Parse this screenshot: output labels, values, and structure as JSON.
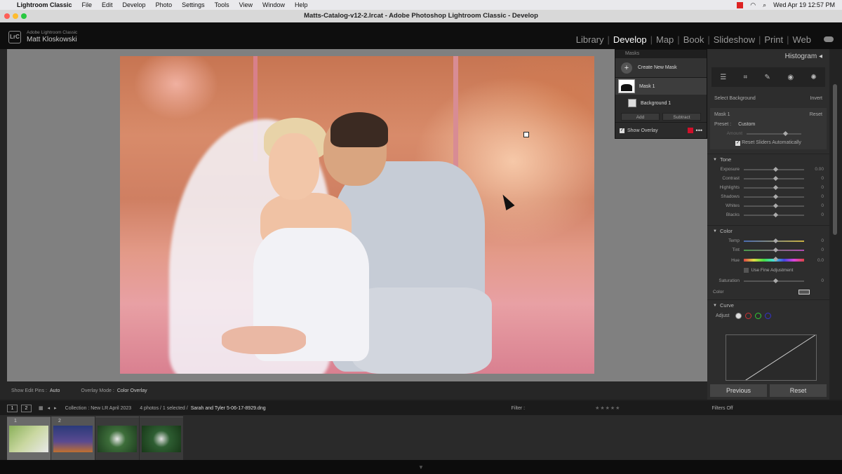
{
  "menubar": {
    "app": "Lightroom Classic",
    "items": [
      "File",
      "Edit",
      "Develop",
      "Photo",
      "Settings",
      "Tools",
      "View",
      "Window",
      "Help"
    ],
    "datetime": "Wed Apr 19  12:57 PM"
  },
  "window": {
    "title": "Matts-Catalog-v12-2.lrcat - Adobe Photoshop Lightroom Classic - Develop"
  },
  "identity": {
    "badge": "LrC",
    "product": "Adobe Lightroom Classic",
    "user": "Matt Kloskowski"
  },
  "modules": [
    {
      "label": "Library"
    },
    {
      "label": "Develop"
    },
    {
      "label": "Map"
    },
    {
      "label": "Book"
    },
    {
      "label": "Slideshow"
    },
    {
      "label": "Print"
    },
    {
      "label": "Web"
    }
  ],
  "masks": {
    "header": "Masks",
    "create_label": "Create New Mask",
    "mask1_label": "Mask 1",
    "component_label": "Background 1",
    "add_label": "Add",
    "subtract_label": "Subtract",
    "show_overlay_label": "Show Overlay",
    "overlay_color": "#d0102a"
  },
  "right_panel": {
    "histogram_label": "Histogram",
    "select_bg_label": "Select Background",
    "invert_label": "Invert",
    "mask_name": "Mask 1",
    "reset_label": "Reset",
    "preset_label": "Preset :",
    "preset_value": "Custom",
    "amount_label": "Amount",
    "reset_sliders_label": "Reset Sliders Automatically",
    "tone_label": "Tone",
    "tone": [
      {
        "label": "Exposure",
        "value": "0.00"
      },
      {
        "label": "Contrast",
        "value": "0"
      },
      {
        "label": "Highlights",
        "value": "0"
      },
      {
        "label": "Shadows",
        "value": "0"
      },
      {
        "label": "Whites",
        "value": "0"
      },
      {
        "label": "Blacks",
        "value": "0"
      }
    ],
    "color_label": "Color",
    "color": [
      {
        "label": "Temp",
        "value": "0"
      },
      {
        "label": "Tint",
        "value": "0"
      },
      {
        "label": "Hue",
        "value": "0.0"
      }
    ],
    "fine_adj_label": "Use Fine Adjustment",
    "saturation": {
      "label": "Saturation",
      "value": "0"
    },
    "color_swatch_label": "Color",
    "curve_label": "Curve",
    "adjust_label": "Adjust",
    "previous_label": "Previous",
    "reset_button_label": "Reset"
  },
  "toolbar": {
    "edit_pins_label": "Show Edit Pins :",
    "edit_pins_value": "Auto",
    "overlay_mode_label": "Overlay Mode :",
    "overlay_mode_value": "Color Overlay"
  },
  "filmstrip": {
    "view1": "1",
    "view2": "2",
    "collection": "Collection : New LR April 2023",
    "count": "4 photos / 1 selected /",
    "filename": "Sarah and Tyler 5-06-17-8929.dng",
    "filter_label": "Filter :",
    "filters_off": "Filters Off",
    "frames": [
      {
        "num": "1",
        "color": "#6b8f4a"
      },
      {
        "num": "2",
        "color": "#35457a"
      },
      {
        "num": "",
        "color": "#3d6e3a"
      },
      {
        "num": "",
        "color": "#2e5e32"
      }
    ]
  }
}
